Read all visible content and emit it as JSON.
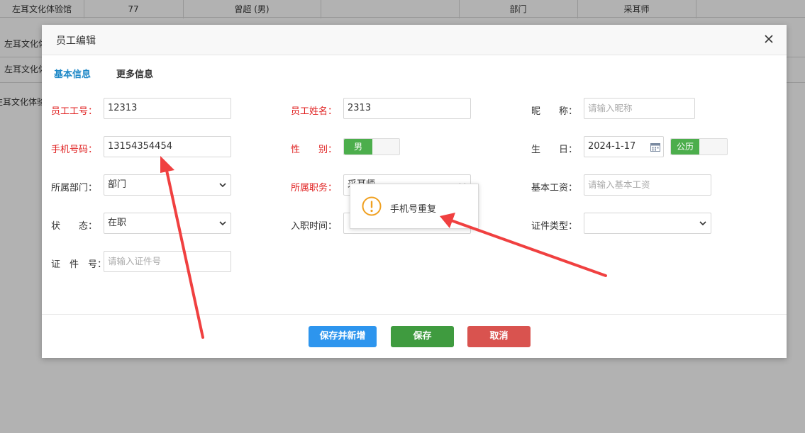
{
  "background": {
    "row1": {
      "org": "左耳文化体验馆",
      "num": "77",
      "person": "曾超 (男)",
      "dept": "部门",
      "role": "采耳师"
    },
    "row2": {
      "org": "左耳文化体验馆"
    },
    "row3": {
      "org": "左耳文化体验馆"
    },
    "row4": {
      "org": "左耳文化体验馆"
    }
  },
  "dialog": {
    "title": "员工编辑",
    "close_icon": "close-icon",
    "tabs": [
      "基本信息",
      "更多信息"
    ],
    "fields": {
      "emp_no": {
        "label": "员工工号：",
        "value": "12313"
      },
      "emp_name": {
        "label": "员工姓名：",
        "value": "2313"
      },
      "nickname": {
        "label": "昵　　称：",
        "placeholder": "请输入昵称"
      },
      "phone": {
        "label": "手机号码：",
        "value": "13154354454"
      },
      "gender": {
        "label": "性　　别：",
        "value": "男"
      },
      "birthday": {
        "label": "生　　日：",
        "value": "2024-1-17",
        "calendar": "公历"
      },
      "dept": {
        "label": "所属部门：",
        "value": "部门"
      },
      "position": {
        "label": "所属职务：",
        "value": "采耳师"
      },
      "salary": {
        "label": "基本工资：",
        "placeholder": "请输入基本工资"
      },
      "status": {
        "label": "状　　态：",
        "value": "在职"
      },
      "hire_date": {
        "label": "入职时间："
      },
      "id_type": {
        "label": "证件类型：",
        "value": ""
      },
      "id_no": {
        "label": "证　件　号：",
        "placeholder": "请输入证件号"
      }
    },
    "buttons": {
      "save_new": "保存并新增",
      "save": "保存",
      "cancel": "取消"
    },
    "toast": "手机号重复"
  },
  "colors": {
    "required_label": "#e02020",
    "tab_active": "#1e88c7",
    "btn_save_new": "#2d95ee",
    "btn_save": "#3f9b3f",
    "btn_cancel": "#d9534f",
    "toggle_on": "#4cae4c",
    "arrow": "#f04040",
    "warn": "#f0a020"
  }
}
